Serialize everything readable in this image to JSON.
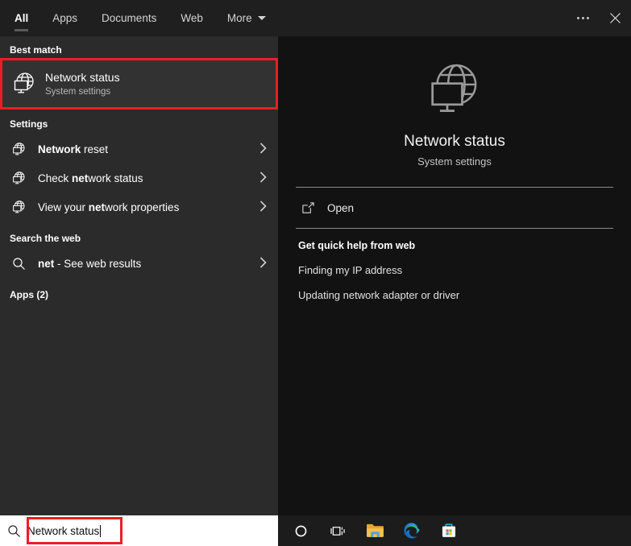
{
  "window": {
    "tabs": [
      {
        "label": "All",
        "active": true,
        "has_caret": false
      },
      {
        "label": "Apps",
        "active": false,
        "has_caret": false
      },
      {
        "label": "Documents",
        "active": false,
        "has_caret": false
      },
      {
        "label": "Web",
        "active": false,
        "has_caret": false
      },
      {
        "label": "More",
        "active": false,
        "has_caret": true
      }
    ],
    "more_options_icon": "ellipsis-icon",
    "close_icon": "close-icon"
  },
  "results": {
    "best_match_heading": "Best match",
    "best_match": {
      "icon": "network-globe-monitor-icon",
      "title": "Network status",
      "subtitle": "System settings",
      "highlighted": true,
      "highlight_color": "#ee1c25"
    },
    "settings_heading": "Settings",
    "settings_items": [
      {
        "icon": "network-globe-monitor-icon",
        "prefix": "",
        "bold": "Network",
        "suffix": " reset",
        "chevron": "chevron-right-icon"
      },
      {
        "icon": "network-globe-monitor-icon",
        "prefix": "Check ",
        "bold": "net",
        "suffix": "work status",
        "chevron": "chevron-right-icon"
      },
      {
        "icon": "network-globe-monitor-icon",
        "prefix": "View your ",
        "bold": "net",
        "suffix": "work properties",
        "chevron": "chevron-right-icon"
      }
    ],
    "web_heading": "Search the web",
    "web_item": {
      "icon": "search-icon",
      "bold": "net",
      "suffix": " - See web results",
      "chevron": "chevron-right-icon"
    },
    "apps_heading": "Apps (2)"
  },
  "preview": {
    "icon": "network-globe-monitor-icon",
    "title": "Network status",
    "subtitle": "System settings",
    "open_icon": "open-external-icon",
    "open_label": "Open",
    "quick_help_heading": "Get quick help from web",
    "quick_help_links": [
      "Finding my IP address",
      "Updating network adapter or driver"
    ]
  },
  "taskbar": {
    "search_icon": "search-icon",
    "search_value": "Network status",
    "search_highlighted": true,
    "highlight_color": "#ee1c25",
    "icons": [
      {
        "name": "cortana-icon"
      },
      {
        "name": "task-view-icon"
      },
      {
        "name": "file-explorer-icon"
      },
      {
        "name": "microsoft-edge-icon"
      },
      {
        "name": "microsoft-store-icon"
      }
    ]
  }
}
